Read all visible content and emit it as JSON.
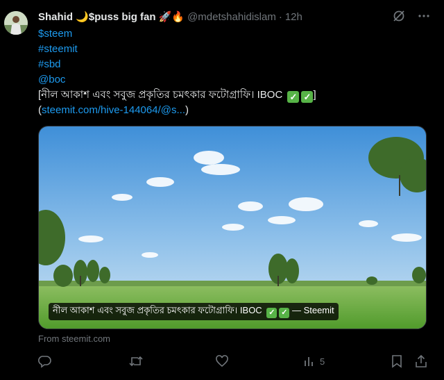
{
  "author": {
    "display_name": "Shahid 🌙$puss big fan 🚀🔥",
    "handle": "@mdetshahidislam",
    "separator": "·",
    "time": "12h"
  },
  "tweet": {
    "tags": [
      "$steem",
      "#steemit",
      "#sbd",
      "@boc"
    ],
    "title_open": "[",
    "title_text": "নীল আকাশ এবং সবুজ প্রকৃতির চমৎকার ফটোগ্রাফি। IBOC",
    "title_close": "]",
    "link_open": "(",
    "link_text": "steemit.com/hive-144064/@s...",
    "link_close": ")"
  },
  "card": {
    "caption_text": "নীল আকাশ এবং সবুজ প্রকৃতির চমৎকার ফটোগ্রাফি। IBOC",
    "caption_suffix": "— Steemit",
    "check_mark": "✓",
    "source": "From steemit.com"
  },
  "actions": {
    "reply_icon": "reply-icon",
    "retweet_icon": "retweet-icon",
    "like_icon": "heart-icon",
    "views_icon": "views-icon",
    "views_count": "5",
    "bookmark_icon": "bookmark-icon",
    "share_icon": "share-icon"
  },
  "colors": {
    "background": "#000000",
    "text": "#e7e9ea",
    "secondary": "#71767b",
    "link": "#1d9bf0",
    "check_green": "#57b347"
  }
}
